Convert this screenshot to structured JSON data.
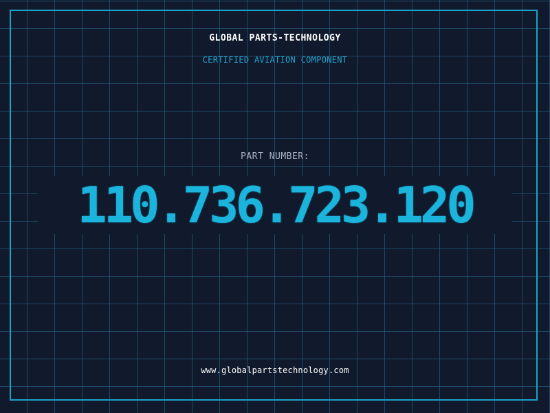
{
  "brand": {
    "title": "GLOBAL PARTS-TECHNOLOGY",
    "subtitle": "CERTIFIED AVIATION COMPONENT"
  },
  "part": {
    "label": "PART NUMBER:",
    "number": "110.736.723.120"
  },
  "footer": {
    "website": "www.globalpartstechnology.com"
  },
  "colors": {
    "background": "#111a2c",
    "grid": "#286e96",
    "accent": "#1ab4dc",
    "frame": "#1aa3c8"
  }
}
